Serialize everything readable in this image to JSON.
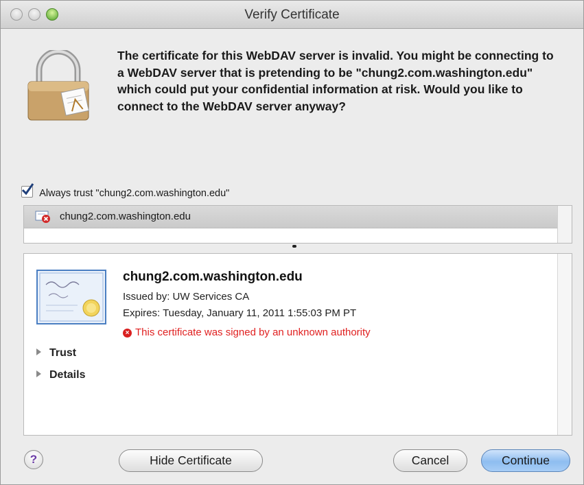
{
  "window": {
    "title": "Verify Certificate"
  },
  "message": "The certificate for this WebDAV server is invalid. You might be connecting to a WebDAV server that is pretending to be \"chung2.com.washington.edu\" which could put your confidential information at risk. Would you like to connect to the WebDAV server anyway?",
  "always_trust": {
    "label": "Always trust \"chung2.com.washington.edu\"",
    "checked": true
  },
  "cert_list": {
    "items": [
      "chung2.com.washington.edu"
    ]
  },
  "certificate": {
    "name": "chung2.com.washington.edu",
    "issued_by": "Issued by: UW Services CA",
    "expires": "Expires: Tuesday, January 11, 2011 1:55:03 PM PT",
    "warning": "This certificate was signed by an unknown authority",
    "sections": [
      "Trust",
      "Details"
    ]
  },
  "buttons": {
    "help": "?",
    "hide_certificate": "Hide Certificate",
    "cancel": "Cancel",
    "continue": "Continue"
  },
  "colors": {
    "warning": "#e02020",
    "default_button": "#8ebdf0"
  }
}
